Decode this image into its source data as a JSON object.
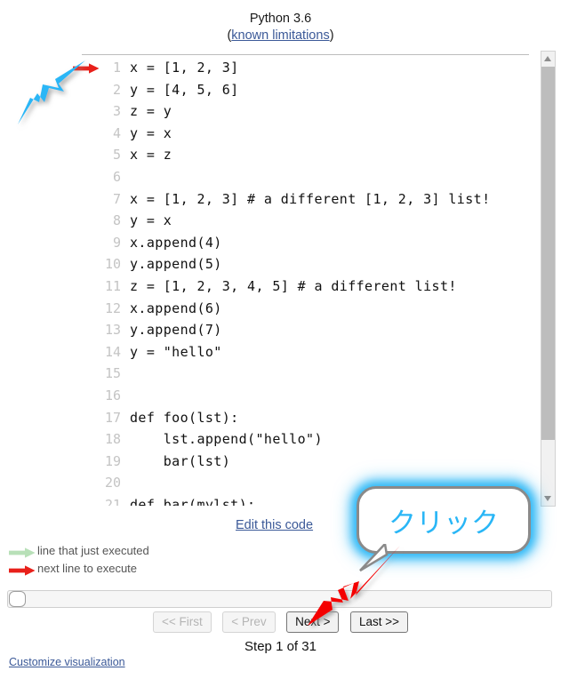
{
  "header": {
    "title": "Python 3.6",
    "limitations_prefix": "(",
    "limitations_link": "known limitations",
    "limitations_suffix": ")"
  },
  "code": {
    "font": "monospace",
    "next_line_marker_row": 1,
    "lines": [
      {
        "num": "1",
        "text": "x = [1, 2, 3]",
        "marker": "next"
      },
      {
        "num": "2",
        "text": "y = [4, 5, 6]",
        "marker": ""
      },
      {
        "num": "3",
        "text": "z = y",
        "marker": ""
      },
      {
        "num": "4",
        "text": "y = x",
        "marker": ""
      },
      {
        "num": "5",
        "text": "x = z",
        "marker": ""
      },
      {
        "num": "6",
        "text": "",
        "marker": ""
      },
      {
        "num": "7",
        "text": "x = [1, 2, 3] # a different [1, 2, 3] list!",
        "marker": ""
      },
      {
        "num": "8",
        "text": "y = x",
        "marker": ""
      },
      {
        "num": "9",
        "text": "x.append(4)",
        "marker": ""
      },
      {
        "num": "10",
        "text": "y.append(5)",
        "marker": ""
      },
      {
        "num": "11",
        "text": "z = [1, 2, 3, 4, 5] # a different list!",
        "marker": ""
      },
      {
        "num": "12",
        "text": "x.append(6)",
        "marker": ""
      },
      {
        "num": "13",
        "text": "y.append(7)",
        "marker": ""
      },
      {
        "num": "14",
        "text": "y = \"hello\"",
        "marker": ""
      },
      {
        "num": "15",
        "text": "",
        "marker": ""
      },
      {
        "num": "16",
        "text": "",
        "marker": ""
      },
      {
        "num": "17",
        "text": "def foo(lst):",
        "marker": ""
      },
      {
        "num": "18",
        "text": "    lst.append(\"hello\")",
        "marker": ""
      },
      {
        "num": "19",
        "text": "    bar(lst)",
        "marker": ""
      },
      {
        "num": "20",
        "text": "",
        "marker": ""
      },
      {
        "num": "21",
        "text": "def bar(mylst):",
        "marker": ""
      }
    ]
  },
  "edit_code_link": "Edit this code",
  "legend": {
    "items": [
      {
        "icon": "arrow-right-icon",
        "color": "#b8e0b8",
        "label": "line that just executed"
      },
      {
        "icon": "arrow-right-icon",
        "color": "#e8201a",
        "label": "next line to execute"
      }
    ]
  },
  "controls": {
    "first_label": "<< First",
    "prev_label": "< Prev",
    "next_label": "Next >",
    "last_label": "Last >>",
    "first_disabled": true,
    "prev_disabled": true,
    "next_disabled": false,
    "last_disabled": false,
    "slider_value": 1,
    "slider_min": 1,
    "slider_max": 31
  },
  "step_label": "Step 1 of 31",
  "customize_link": "Customize visualization",
  "annotations": {
    "callout_text": "クリック",
    "callout_border_color": "#29b6f6",
    "blue_arrow_color": "#29b6f6",
    "red_arrow_color": "#f40000"
  },
  "colors": {
    "link": "#3b5998",
    "lineno": "#c4c4c4",
    "code_text": "#111111",
    "divider": "#bcbcbc",
    "next_marker": "#e8201a",
    "just_executed_marker": "#b8e0b8",
    "scrollbar_thumb": "#bdbdbd"
  }
}
